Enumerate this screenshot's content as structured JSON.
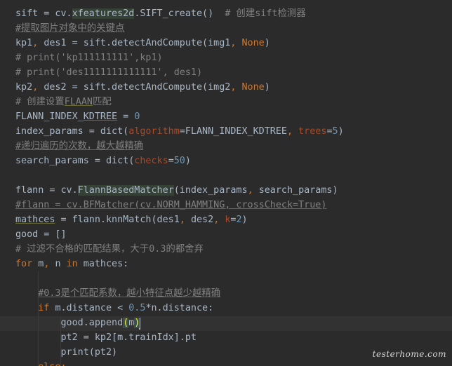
{
  "editor": {
    "language": "python",
    "theme_colors": {
      "background": "#2b2b2b",
      "text": "#a9b7c6",
      "keyword": "#cc7832",
      "number": "#6897bb",
      "string": "#6a8759",
      "comment": "#808080",
      "kwarg": "#aa4926"
    },
    "lines": [
      [
        {
          "t": "sift = cv.",
          "c": ""
        },
        {
          "t": "xfeatures2d",
          "c": "tok-hl"
        },
        {
          "t": ".SIFT_create()  ",
          "c": ""
        },
        {
          "t": "# 创建sift检测器",
          "c": "tok-com"
        }
      ],
      [
        {
          "t": "#提取图片对象中的关键点",
          "c": "tok-com tok-und"
        }
      ],
      [
        {
          "t": "kp1",
          "c": ""
        },
        {
          "t": ", ",
          "c": "tok-kw"
        },
        {
          "t": "des1 = sift.detectAndCompute(img1",
          "c": ""
        },
        {
          "t": ", ",
          "c": "tok-kw"
        },
        {
          "t": "None",
          "c": "tok-kw"
        },
        {
          "t": ")",
          "c": ""
        }
      ],
      [
        {
          "t": "# print('kp111111111',kp1)",
          "c": "tok-com"
        }
      ],
      [
        {
          "t": "# print('des1111111111111', des1)",
          "c": "tok-com"
        }
      ],
      [
        {
          "t": "kp2",
          "c": ""
        },
        {
          "t": ", ",
          "c": "tok-kw"
        },
        {
          "t": "des2 = sift.detectAndCompute(img2",
          "c": ""
        },
        {
          "t": ", ",
          "c": "tok-kw"
        },
        {
          "t": "None",
          "c": "tok-kw"
        },
        {
          "t": ")",
          "c": ""
        }
      ],
      [
        {
          "t": "# 创建设置",
          "c": "tok-com"
        },
        {
          "t": "FLAAN",
          "c": "tok-com tok-und"
        },
        {
          "t": "匹配",
          "c": "tok-com"
        }
      ],
      [
        {
          "t": "FLANN_INDEX_",
          "c": ""
        },
        {
          "t": "KDTREE",
          "c": "tok-und"
        },
        {
          "t": " = ",
          "c": ""
        },
        {
          "t": "0",
          "c": "tok-num"
        }
      ],
      [
        {
          "t": "index_params = dict(",
          "c": ""
        },
        {
          "t": "algorithm",
          "c": "tok-kwarg"
        },
        {
          "t": "=FLANN_INDEX_KDTREE",
          "c": ""
        },
        {
          "t": ", ",
          "c": "tok-kw"
        },
        {
          "t": "trees",
          "c": "tok-kwarg"
        },
        {
          "t": "=",
          "c": ""
        },
        {
          "t": "5",
          "c": "tok-num"
        },
        {
          "t": ")",
          "c": ""
        }
      ],
      [
        {
          "t": "#递归遍历的次数，越大越精确",
          "c": "tok-com tok-und"
        }
      ],
      [
        {
          "t": "search_params = dict(",
          "c": ""
        },
        {
          "t": "checks",
          "c": "tok-kwarg"
        },
        {
          "t": "=",
          "c": ""
        },
        {
          "t": "50",
          "c": "tok-num"
        },
        {
          "t": ")",
          "c": ""
        }
      ],
      [],
      [
        {
          "t": "flann = cv.",
          "c": ""
        },
        {
          "t": "FlannBasedMatcher",
          "c": "tok-hl"
        },
        {
          "t": "(index_params",
          "c": ""
        },
        {
          "t": ", ",
          "c": "tok-kw"
        },
        {
          "t": "search_params)",
          "c": ""
        }
      ],
      [
        {
          "t": "#flann = cv.BFMatcher(cv.NORM_HAMMING, crossCheck=True)",
          "c": "tok-com tok-und"
        }
      ],
      [
        {
          "t": "mathces",
          "c": "tok-und"
        },
        {
          "t": " = flann.knnMatch(des1",
          "c": ""
        },
        {
          "t": ", ",
          "c": "tok-kw"
        },
        {
          "t": "des2",
          "c": ""
        },
        {
          "t": ", ",
          "c": "tok-kw"
        },
        {
          "t": "k",
          "c": "tok-kwarg"
        },
        {
          "t": "=",
          "c": ""
        },
        {
          "t": "2",
          "c": "tok-num"
        },
        {
          "t": ")",
          "c": ""
        }
      ],
      [
        {
          "t": "good = []",
          "c": ""
        }
      ],
      [
        {
          "t": "# 过滤不合格的匹配结果，大于0.3的都舍弃",
          "c": "tok-com"
        }
      ],
      [
        {
          "t": "for ",
          "c": "tok-kw"
        },
        {
          "t": "m",
          "c": ""
        },
        {
          "t": ", ",
          "c": "tok-kw"
        },
        {
          "t": "n ",
          "c": ""
        },
        {
          "t": "in ",
          "c": "tok-kw"
        },
        {
          "t": "mathces:",
          "c": ""
        }
      ],
      [],
      [
        {
          "t": "    ",
          "c": ""
        },
        {
          "t": "#0.3是个匹配系数，越小特征点越少越精确",
          "c": "tok-com tok-und"
        }
      ],
      [
        {
          "t": "    ",
          "c": ""
        },
        {
          "t": "if ",
          "c": "tok-kw"
        },
        {
          "t": "m.distance < ",
          "c": ""
        },
        {
          "t": "0.5",
          "c": "tok-num"
        },
        {
          "t": "*n.distance:",
          "c": ""
        }
      ],
      [
        {
          "t": "        good.append",
          "c": ""
        },
        {
          "t": "(",
          "c": "tok-paren"
        },
        {
          "t": "m",
          "c": ""
        },
        {
          "t": ")",
          "c": "tok-paren"
        }
      ],
      [
        {
          "t": "        pt2 = kp2[m.trainIdx].pt",
          "c": ""
        }
      ],
      [
        {
          "t": "        print(pt2)",
          "c": ""
        }
      ],
      [
        {
          "t": "    ",
          "c": ""
        },
        {
          "t": "else:",
          "c": "tok-kw"
        }
      ]
    ]
  },
  "watermark": {
    "text": "testerhome.com"
  }
}
